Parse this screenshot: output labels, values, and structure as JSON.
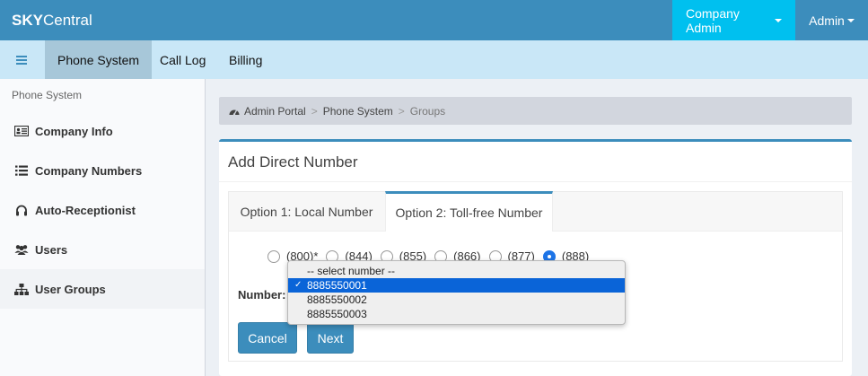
{
  "app": {
    "logo_bold": "SKY",
    "logo_rest": "Central"
  },
  "top_menu": {
    "company_admin": "Company Admin",
    "admin": "Admin"
  },
  "subnav": {
    "tabs": [
      {
        "label": "Phone System"
      },
      {
        "label": "Call Log"
      },
      {
        "label": "Billing"
      }
    ]
  },
  "sidebar": {
    "header": "Phone System",
    "items": [
      {
        "label": "Company Info",
        "icon": "id-card-icon"
      },
      {
        "label": "Company Numbers",
        "icon": "list-icon"
      },
      {
        "label": "Auto-Receptionist",
        "icon": "headset-icon"
      },
      {
        "label": "Users",
        "icon": "users-icon"
      },
      {
        "label": "User Groups",
        "icon": "sitemap-icon"
      }
    ]
  },
  "breadcrumb": {
    "items": [
      "Admin Portal",
      "Phone System",
      "Groups"
    ],
    "separator": ">"
  },
  "box": {
    "title": "Add Direct Number",
    "tabs": [
      {
        "label": "Option 1: Local Number"
      },
      {
        "label": "Option 2: Toll-free Number"
      }
    ],
    "radios": [
      {
        "label": "(800)*",
        "checked": false
      },
      {
        "label": "(844)",
        "checked": false
      },
      {
        "label": "(855)",
        "checked": false
      },
      {
        "label": "(866)",
        "checked": false
      },
      {
        "label": "(877)",
        "checked": false
      },
      {
        "label": "(888)",
        "checked": true
      }
    ],
    "number_label": "Number:",
    "cancel": "Cancel",
    "next": "Next"
  },
  "dropdown": {
    "options": [
      {
        "label": "-- select number --",
        "selected": false
      },
      {
        "label": "8885550001",
        "selected": true
      },
      {
        "label": "8885550002",
        "selected": false
      },
      {
        "label": "8885550003",
        "selected": false
      }
    ],
    "check": "✓"
  },
  "colors": {
    "header": "#3c8dbc",
    "company_admin_bg": "#00c0ef",
    "subnav_bg": "#c9e7f7",
    "selected_option": "#0a64d8"
  }
}
